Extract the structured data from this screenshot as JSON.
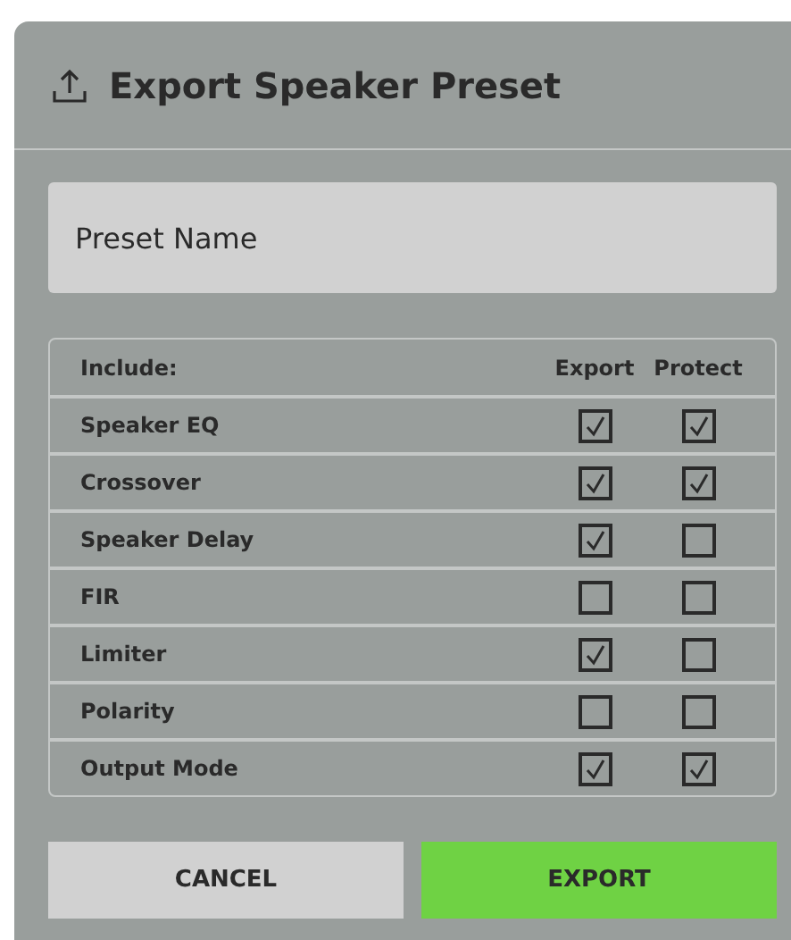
{
  "dialog": {
    "title": "Export Speaker Preset"
  },
  "name_field": {
    "placeholder": "Preset Name"
  },
  "table": {
    "columns": [
      "Include:",
      "Export",
      "Protect"
    ],
    "rows": [
      {
        "label": "Speaker EQ",
        "export": true,
        "protect": true
      },
      {
        "label": "Crossover",
        "export": true,
        "protect": true
      },
      {
        "label": "Speaker Delay",
        "export": true,
        "protect": false
      },
      {
        "label": "FIR",
        "export": false,
        "protect": false
      },
      {
        "label": "Limiter",
        "export": true,
        "protect": false
      },
      {
        "label": "Polarity",
        "export": false,
        "protect": false
      },
      {
        "label": "Output Mode",
        "export": true,
        "protect": true
      }
    ]
  },
  "buttons": [
    {
      "label": "CANCEL",
      "kind": "secondary"
    },
    {
      "label": "EXPORT",
      "kind": "primary"
    }
  ]
}
